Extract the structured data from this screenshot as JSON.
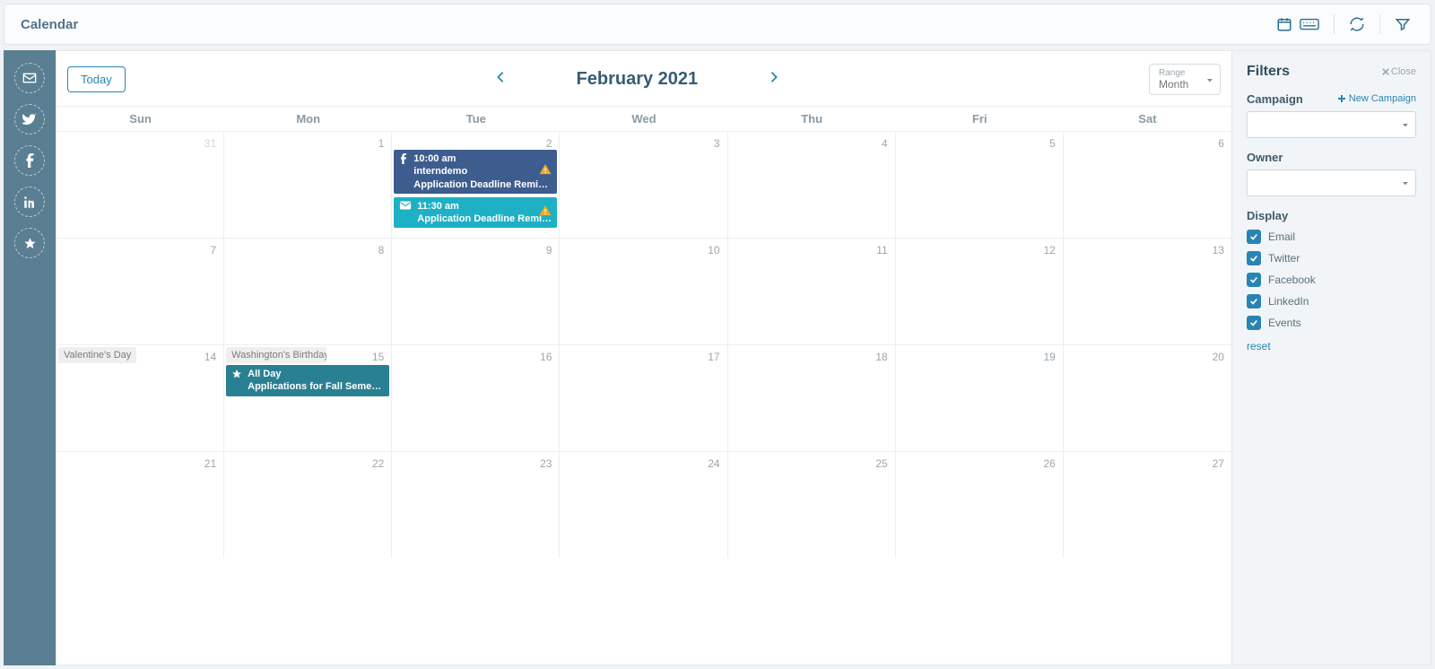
{
  "pageTitle": "Calendar",
  "topbar": {
    "icons": [
      "calendar-icon",
      "keyboard-icon",
      "refresh-icon",
      "filter-icon"
    ]
  },
  "header": {
    "today": "Today",
    "title": "February 2021",
    "range": {
      "label": "Range",
      "value": "Month"
    }
  },
  "dow": [
    "Sun",
    "Mon",
    "Tue",
    "Wed",
    "Thu",
    "Fri",
    "Sat"
  ],
  "days": [
    {
      "n": "31",
      "muted": true
    },
    {
      "n": "1"
    },
    {
      "n": "2",
      "events": [
        {
          "kind": "deepblue",
          "icon": "facebook",
          "time": "10:00 am",
          "line1": "interndemo",
          "line2": "Application Deadline Reminder",
          "warn": true
        },
        {
          "kind": "teal",
          "icon": "mail",
          "time": "11:30 am",
          "line1": "",
          "line2": "Application Deadline Reminder",
          "warn": true
        }
      ]
    },
    {
      "n": "3"
    },
    {
      "n": "4"
    },
    {
      "n": "5"
    },
    {
      "n": "6"
    },
    {
      "n": "7"
    },
    {
      "n": "8"
    },
    {
      "n": "9"
    },
    {
      "n": "10"
    },
    {
      "n": "11"
    },
    {
      "n": "12"
    },
    {
      "n": "13"
    },
    {
      "n": "14",
      "holiday": "Valentine's Day"
    },
    {
      "n": "15",
      "holiday": "Washington's Birthday",
      "events": [
        {
          "kind": "darkteal",
          "icon": "star",
          "time": "All Day",
          "line1": "",
          "line2": "Applications for Fall Semester"
        }
      ]
    },
    {
      "n": "16"
    },
    {
      "n": "17"
    },
    {
      "n": "18"
    },
    {
      "n": "19"
    },
    {
      "n": "20"
    },
    {
      "n": "21"
    },
    {
      "n": "22"
    },
    {
      "n": "23"
    },
    {
      "n": "24"
    },
    {
      "n": "25"
    },
    {
      "n": "26"
    },
    {
      "n": "27"
    }
  ],
  "filters": {
    "title": "Filters",
    "close": "Close",
    "campaign": {
      "label": "Campaign",
      "newLabel": "New Campaign"
    },
    "owner": {
      "label": "Owner"
    },
    "display": {
      "label": "Display",
      "items": [
        "Email",
        "Twitter",
        "Facebook",
        "LinkedIn",
        "Events"
      ]
    },
    "reset": "reset"
  }
}
